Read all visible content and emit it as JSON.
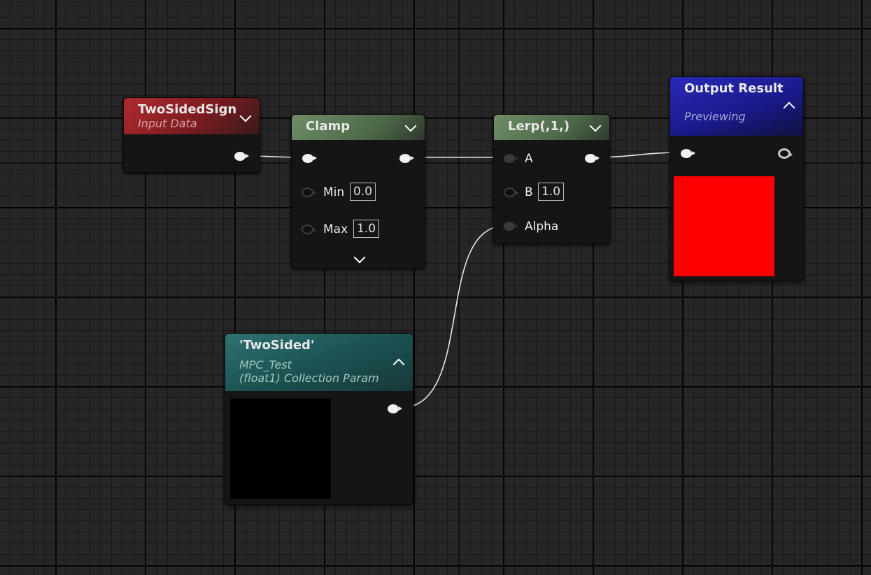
{
  "nodes": {
    "two_sided_sign": {
      "title": "TwoSidedSign",
      "subtitle": "Input Data",
      "header_color": "#8e1f24"
    },
    "clamp": {
      "title": "Clamp",
      "min_label": "Min",
      "min_value": "0.0",
      "max_label": "Max",
      "max_value": "1.0",
      "header_color": "#5b7a55"
    },
    "lerp": {
      "title": "Lerp(,1,)",
      "a_label": "A",
      "b_label": "B",
      "b_value": "1.0",
      "alpha_label": "Alpha",
      "header_color": "#5b7a55"
    },
    "output_result": {
      "title": "Output Result",
      "subtitle": "Previewing",
      "header_color": "#1c1c8a",
      "preview_color": "#ff0000"
    },
    "two_sided_param": {
      "title": "'TwoSided'",
      "subtitle1": "MPC_Test",
      "subtitle2": "(float1) Collection Param",
      "header_color": "#1c5a5a",
      "preview_color": "#000000"
    }
  }
}
